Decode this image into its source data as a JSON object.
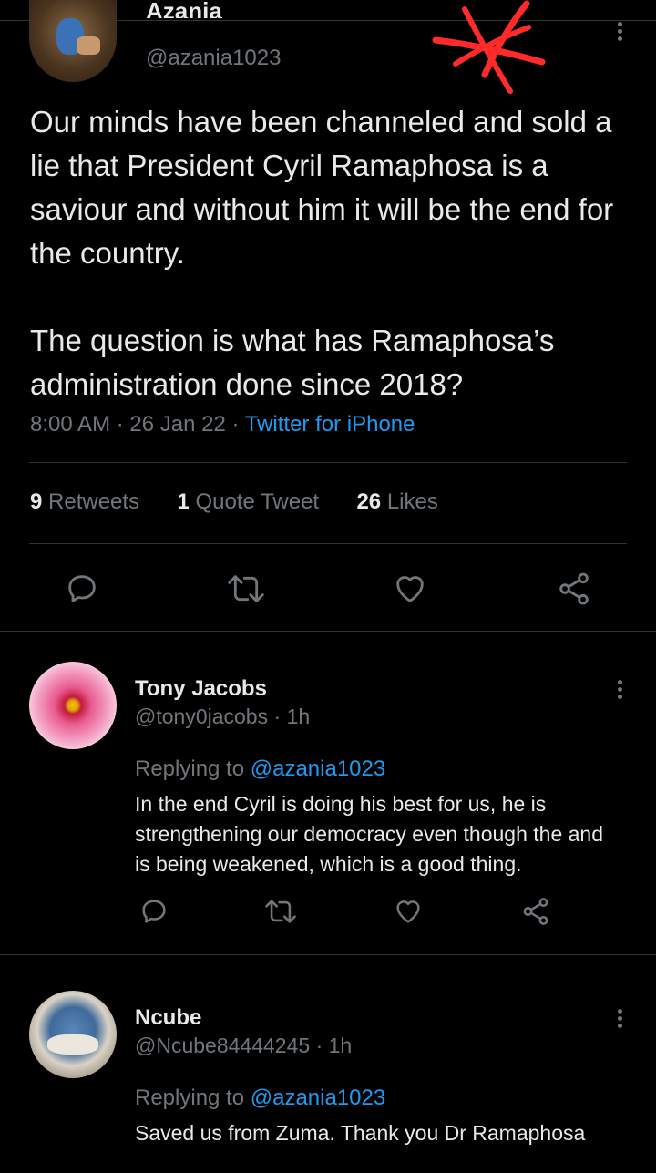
{
  "tweet": {
    "author_name": "Azania",
    "author_handle": "@azania1023",
    "text_paragraphs": [
      "Our minds have been channeled and sold a lie that President Cyril Ramaphosa is a saviour and without him it will be the end for the country.",
      "The question is what has Ramaphosa’s administration done since 2018?"
    ],
    "time": "8:00 AM",
    "date": "26 Jan 22",
    "separator": "·",
    "source": "Twitter for iPhone",
    "stats": {
      "retweets_count": "9",
      "retweets_label": "Retweets",
      "quotes_count": "1",
      "quotes_label": "Quote Tweet",
      "likes_count": "26",
      "likes_label": "Likes"
    }
  },
  "replies": [
    {
      "name": "Tony Jacobs",
      "handle": "@tony0jacobs",
      "time": "1h",
      "replying_prefix": "Replying to",
      "replying_to": "@azania1023",
      "text": "In the end Cyril is doing his best for us, he is strengthening our democracy even though the and is being weakened, which is a good thing."
    },
    {
      "name": "Ncube",
      "handle": "@Ncube84444245",
      "time": "1h",
      "replying_prefix": "Replying to",
      "replying_to": "@azania1023",
      "text": "Saved us from Zuma. Thank you Dr Ramaphosa"
    }
  ],
  "colors": {
    "background": "#000000",
    "text": "#e7e9ea",
    "muted": "#71767b",
    "link": "#1d9bf0",
    "annotation": "#ff2a2a"
  },
  "icons": [
    "reply-icon",
    "retweet-icon",
    "like-icon",
    "share-icon",
    "more-icon"
  ]
}
